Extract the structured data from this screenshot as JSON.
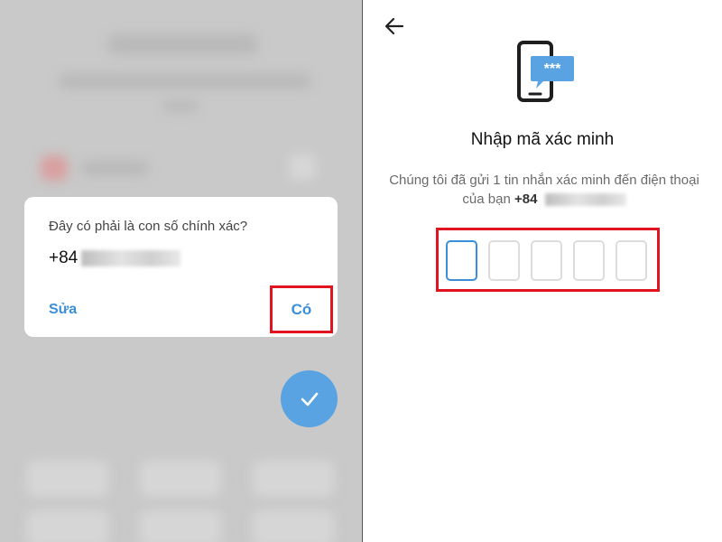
{
  "left_screen": {
    "dialog": {
      "question": "Đây có phải là con số chính xác?",
      "phone_prefix": "+84",
      "edit_label": "Sửa",
      "confirm_label": "Có"
    },
    "fab_icon": "check-icon"
  },
  "right_screen": {
    "back_icon": "arrow-left-icon",
    "header_icon": "phone-sms-icon",
    "header_icon_text": "***",
    "title": "Nhập mã xác minh",
    "description_line1": "Chúng tôi đã gửi 1 tin nhắn xác minh đến điện thoại",
    "description_line2": "của bạn",
    "phone_prefix": "+84",
    "code_length": 5
  },
  "colors": {
    "accent": "#3a8fd8",
    "fab": "#5aa3e2",
    "highlight": "#e0141e"
  }
}
